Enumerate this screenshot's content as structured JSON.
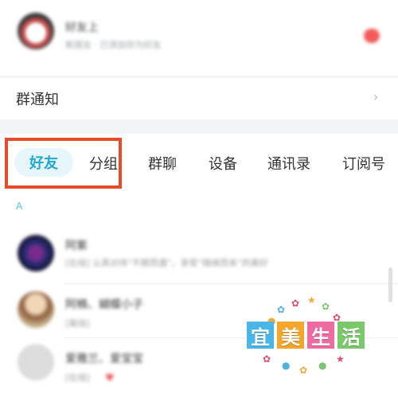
{
  "notifications": {
    "top_item": {
      "name": "好友上",
      "subtitle": "新朋友   · 已添加你为好友"
    },
    "group_notice": {
      "label": "群通知",
      "chevron": "chevron-right-icon"
    }
  },
  "tabs": {
    "items": [
      {
        "label": "好友",
        "active": true
      },
      {
        "label": "分组"
      },
      {
        "label": "群聊"
      },
      {
        "label": "设备"
      },
      {
        "label": "通讯录"
      },
      {
        "label": "订阅号"
      }
    ]
  },
  "contacts": {
    "section_letter": "A",
    "items": [
      {
        "name": "阿紫",
        "subtitle": "[在线] 认真对待“不期而遇”，享受“随缘而来”的美好"
      },
      {
        "name": "阿楠、蝴蝶小子",
        "subtitle": "[离线]"
      },
      {
        "name": "爱雅兰、爱宝宝",
        "subtitle": "[在线]"
      }
    ]
  },
  "watermark": {
    "chars": [
      "宜",
      "美",
      "生",
      "活"
    ]
  },
  "colors": {
    "accent": "#21a7d6",
    "highlight": "#e84a2a",
    "badge": "#f25b5b",
    "tab_active_bg": "#e7f6fb"
  }
}
